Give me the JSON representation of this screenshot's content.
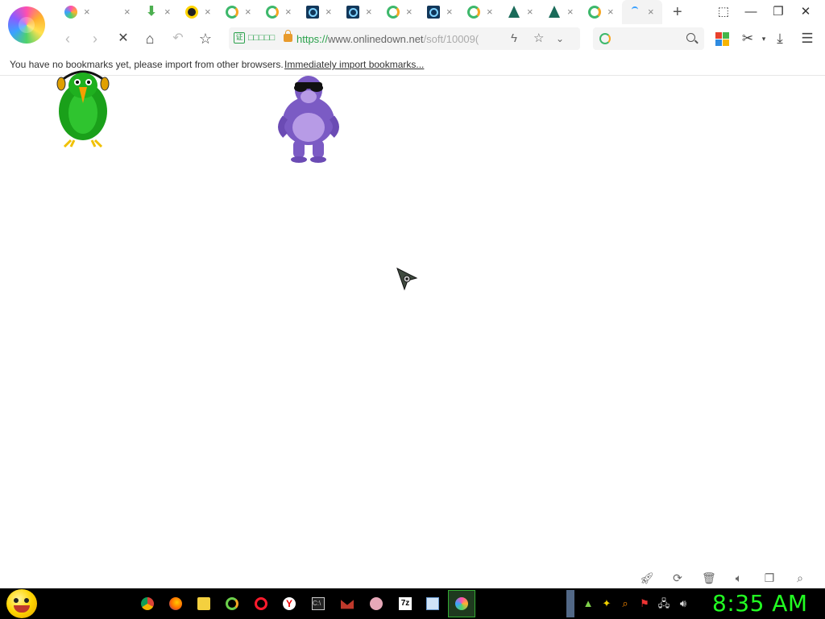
{
  "browser": {
    "tabs": [
      {
        "icon": "colorful-swirl-icon",
        "close": "×"
      },
      {
        "icon": "blank-icon",
        "close": "×"
      },
      {
        "icon": "green-download-icon",
        "close": "×"
      },
      {
        "icon": "yellow-ball-icon",
        "close": "×"
      },
      {
        "icon": "green-ring-icon",
        "close": "×"
      },
      {
        "icon": "green-ring-icon",
        "close": "×"
      },
      {
        "icon": "q-app-icon",
        "close": "×"
      },
      {
        "icon": "q-app-icon",
        "close": "×"
      },
      {
        "icon": "green-ring-icon",
        "close": "×"
      },
      {
        "icon": "q-app-icon",
        "close": "×"
      },
      {
        "icon": "green-ring-icon",
        "close": "×"
      },
      {
        "icon": "tree-icon",
        "close": "×"
      },
      {
        "icon": "tree-icon",
        "close": "×"
      },
      {
        "icon": "green-ring-icon",
        "close": "×"
      },
      {
        "icon": "loading-spinner-icon",
        "close": "×",
        "active": true
      }
    ],
    "new_tab": "+",
    "window_controls": {
      "minimize": "—",
      "restore": "❐",
      "close": "✕",
      "skin": "⬚"
    },
    "address": {
      "secure_badge": "证",
      "secure_label": "□□□□□",
      "url_scheme": "https://",
      "url_host": "www.onlinedown.net",
      "url_path": "/soft/10009("
    },
    "search": {
      "placeholder": ""
    },
    "bookmark_bar": {
      "message": "You have no bookmarks yet, please import from other browsers.",
      "import_link": "Immediately import bookmarks..."
    },
    "colors": {
      "accent_green": "#2aa14b",
      "clock_green": "#22ff22"
    }
  },
  "content": {
    "desktop_buddies": [
      "parrot-with-headphones",
      "purple-gorilla-with-sunglasses"
    ]
  },
  "taskbar": {
    "apps": [
      "chrome",
      "firefox",
      "file-manager",
      "swirl-green",
      "opera",
      "yandex",
      "terminal",
      "mail",
      "brain",
      "7zip",
      "notepad",
      "browser-swirl"
    ],
    "clock": "8:35 AM"
  }
}
